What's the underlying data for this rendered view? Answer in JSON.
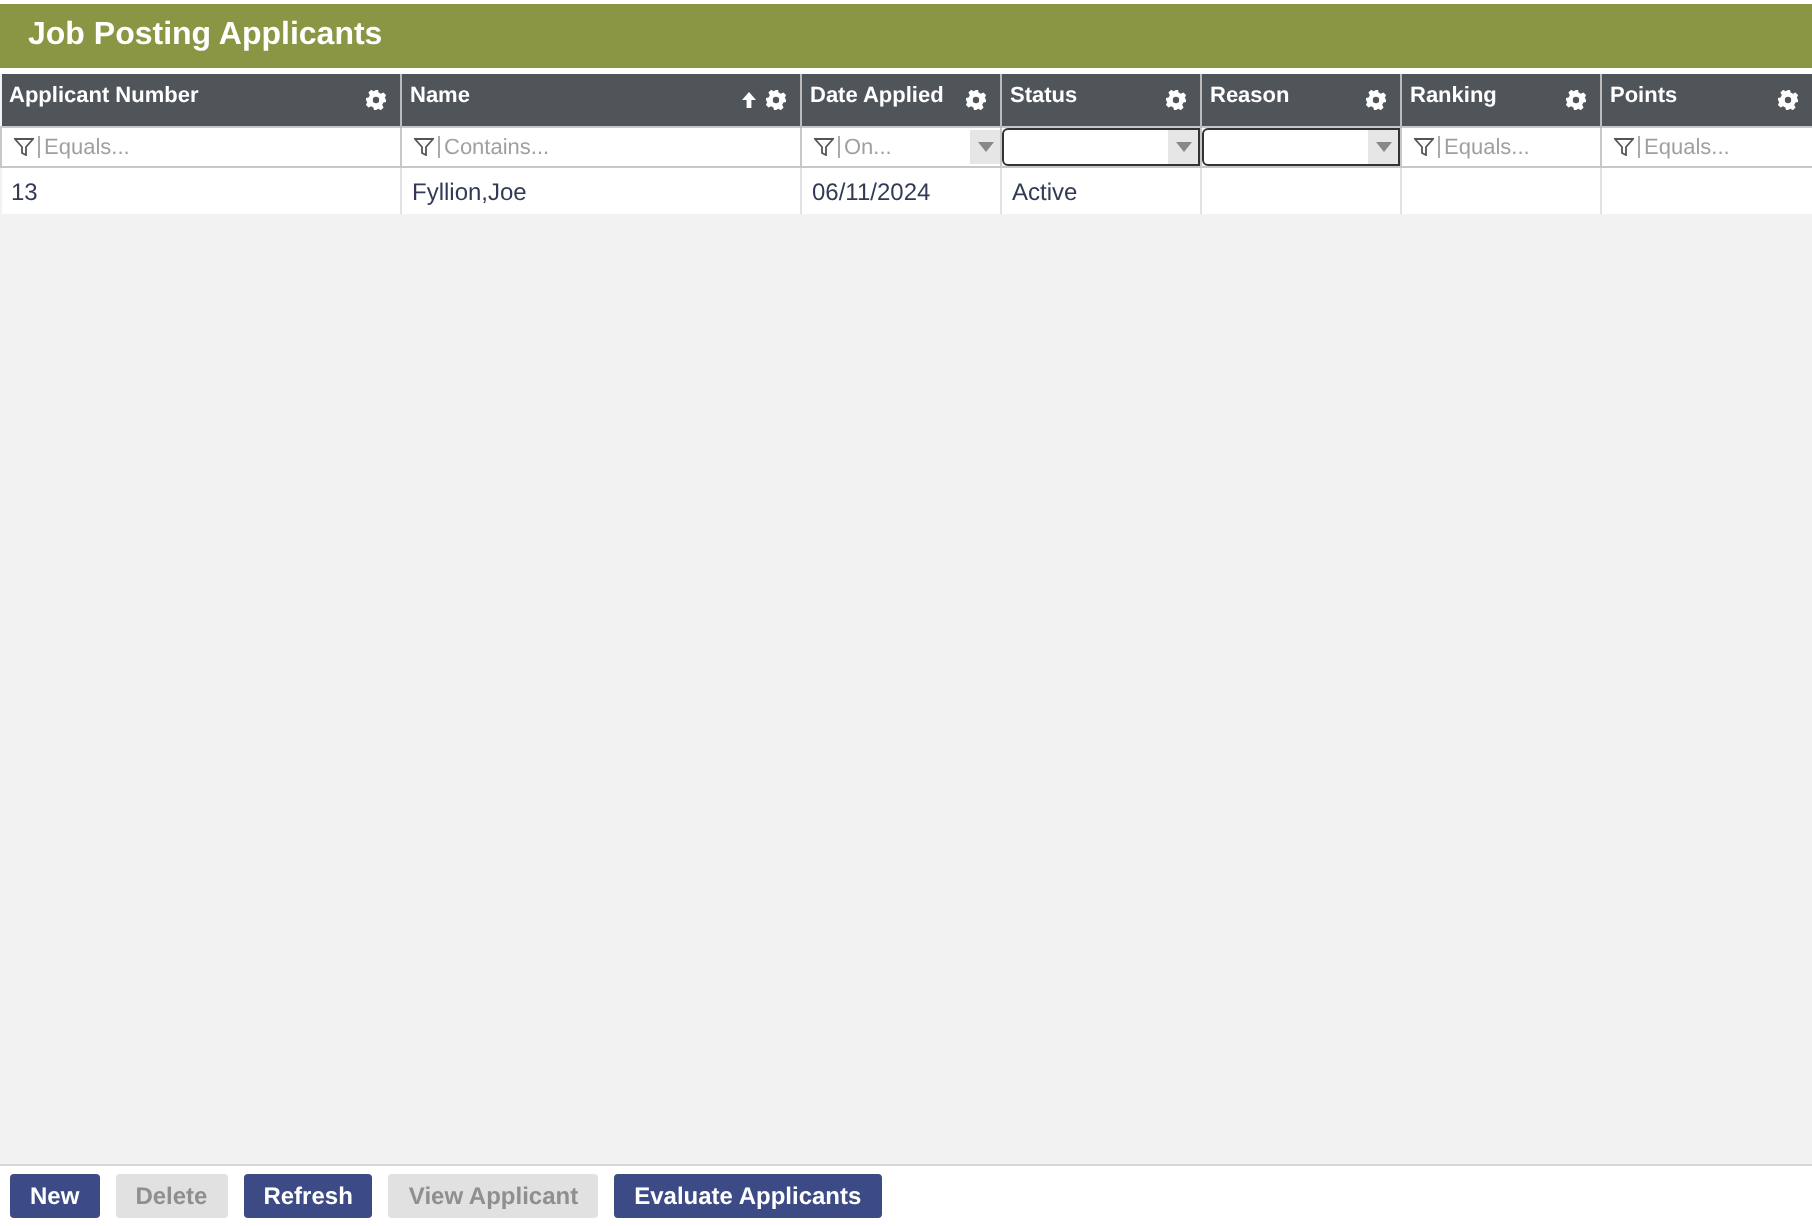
{
  "title": "Job Posting Applicants",
  "table": {
    "columns": [
      {
        "label": "Applicant Number",
        "sorted": false,
        "filter": {
          "kind": "text",
          "placeholder": "Equals..."
        }
      },
      {
        "label": "Name",
        "sorted": true,
        "filter": {
          "kind": "text",
          "placeholder": "Contains..."
        }
      },
      {
        "label": "Date Applied",
        "sorted": false,
        "filter": {
          "kind": "date",
          "placeholder": "On..."
        }
      },
      {
        "label": "Status",
        "sorted": false,
        "filter": {
          "kind": "select"
        }
      },
      {
        "label": "Reason",
        "sorted": false,
        "filter": {
          "kind": "select"
        }
      },
      {
        "label": "Ranking",
        "sorted": false,
        "filter": {
          "kind": "text",
          "placeholder": "Equals..."
        }
      },
      {
        "label": "Points",
        "sorted": false,
        "filter": {
          "kind": "text",
          "placeholder": "Equals..."
        }
      }
    ],
    "rows": [
      {
        "cells": [
          "13",
          "Fyllion,Joe",
          "06/11/2024",
          "Active",
          "",
          "",
          ""
        ]
      }
    ]
  },
  "buttons": [
    {
      "label": "New",
      "disabled": false
    },
    {
      "label": "Delete",
      "disabled": true
    },
    {
      "label": "Refresh",
      "disabled": false
    },
    {
      "label": "View Applicant",
      "disabled": true
    },
    {
      "label": "Evaluate Applicants",
      "disabled": false
    }
  ]
}
